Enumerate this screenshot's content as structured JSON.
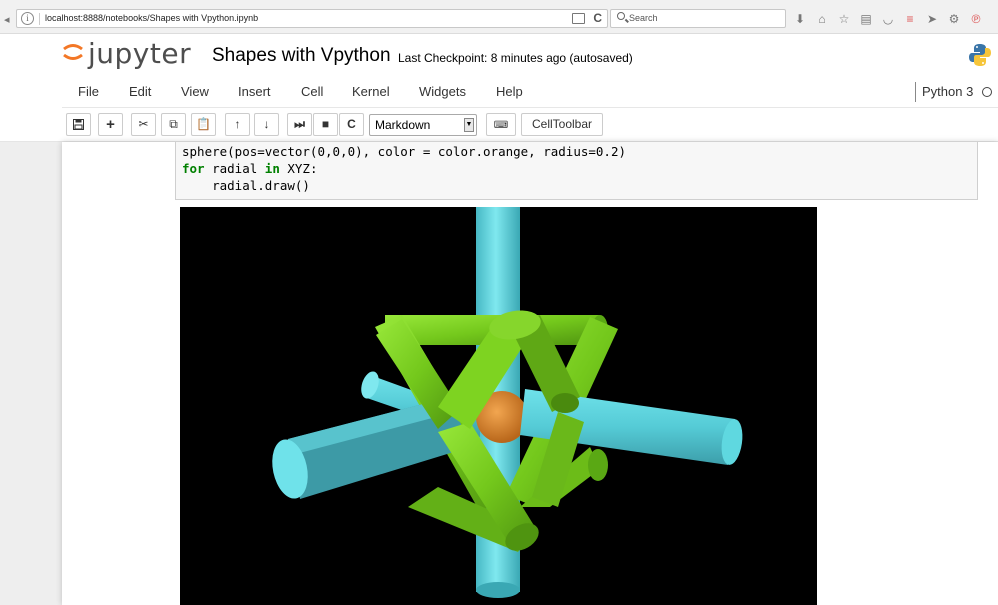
{
  "browser": {
    "url": "localhost:8888/notebooks/Shapes with Vpython.ipynb",
    "search_placeholder": "Search",
    "icons": [
      "info-icon",
      "reader-view-icon",
      "reload-icon",
      "search-icon",
      "download-icon",
      "home-icon",
      "bookmark-star-icon",
      "library-icon",
      "pocket-icon",
      "extension-icon",
      "send-icon",
      "settings-icon",
      "pinterest-icon"
    ]
  },
  "header": {
    "logo_text": "jupyter",
    "notebook_title": "Shapes with Vpython",
    "checkpoint": "Last Checkpoint: 8 minutes ago (autosaved)"
  },
  "menu": {
    "items": [
      "File",
      "Edit",
      "View",
      "Insert",
      "Cell",
      "Kernel",
      "Widgets",
      "Help"
    ],
    "kernel_name": "Python 3"
  },
  "toolbar": {
    "cell_type": "Markdown",
    "celltoolbar_label": "CellToolbar",
    "icons": [
      "save-icon",
      "plus-icon",
      "cut-icon",
      "copy-icon",
      "paste-icon",
      "arrow-up-icon",
      "arrow-down-icon",
      "run-icon",
      "stop-icon",
      "restart-icon",
      "keyboard-icon"
    ]
  },
  "cell": {
    "line1": "sphere(pos=vector(0,0,0), color = color.orange, radius=0.2)",
    "line2_kw1": "for",
    "line2_var": " radial ",
    "line2_kw2": "in",
    "line2_rest": " XYZ:",
    "line3": "    radial.draw()"
  },
  "colors": {
    "cylinder_cyan": "#5fd8e0",
    "cylinder_green": "#7ed321",
    "sphere_orange": "#e08a32",
    "canvas_bg": "#000000"
  }
}
